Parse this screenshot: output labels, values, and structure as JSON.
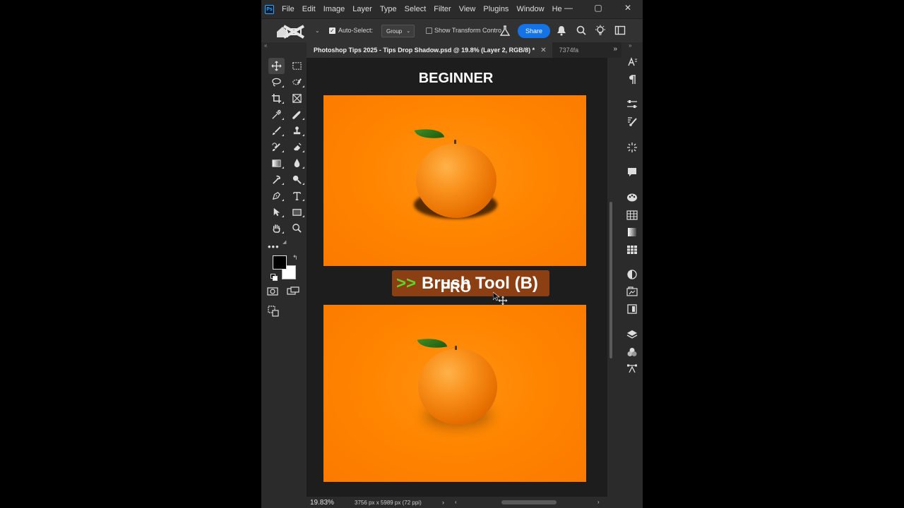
{
  "app": {
    "logo_text": "Ps",
    "menu": [
      "File",
      "Edit",
      "Image",
      "Layer",
      "Type",
      "Select",
      "Filter",
      "View",
      "Plugins",
      "Window",
      "He"
    ],
    "window_controls": {
      "minimize": "—",
      "restore": "▢",
      "close": "✕"
    }
  },
  "options": {
    "autoselect_label": "Auto-Select:",
    "autoselect_checked": true,
    "group_value": "Group",
    "transform_label": "Show Transform Contro",
    "transform_checked": false,
    "share_label": "Share"
  },
  "tabs": {
    "active_title": "Photoshop Tips 2025 - Tips Drop Shadow.psd @ 19.8% (Layer 2, RGB/8) *",
    "close": "✕",
    "second_title": "7374fa",
    "overflow": "»"
  },
  "canvas": {
    "heading_beginner": "BEGINNER",
    "heading_pro": "PRO",
    "label_arrows": ">>",
    "label_text": "Brush Tool (B)",
    "colors": {
      "orange": "#ff8500",
      "label_bg": "#8d3f14",
      "arrows": "#5ed42a"
    }
  },
  "tools": [
    "move-tool",
    "marquee-tool",
    "lasso-tool",
    "quick-selection-tool",
    "crop-tool",
    "frame-tool",
    "eyedropper-tool",
    "spot-healing-tool",
    "brush-tool",
    "clone-stamp-tool",
    "history-brush-tool",
    "eraser-tool",
    "gradient-tool",
    "blur-tool",
    "dodge-tool",
    "pen-tool",
    "smudge-tool",
    "type-tool",
    "path-selection-tool",
    "rectangle-tool",
    "hand-tool",
    "zoom-tool"
  ],
  "toolbar_extra": {
    "more_label": "•••"
  },
  "status": {
    "zoom": "19.83%",
    "doc_info": "3756 px x 5989 px (72 ppi)"
  },
  "accent": {
    "share_blue": "#1473e6"
  }
}
